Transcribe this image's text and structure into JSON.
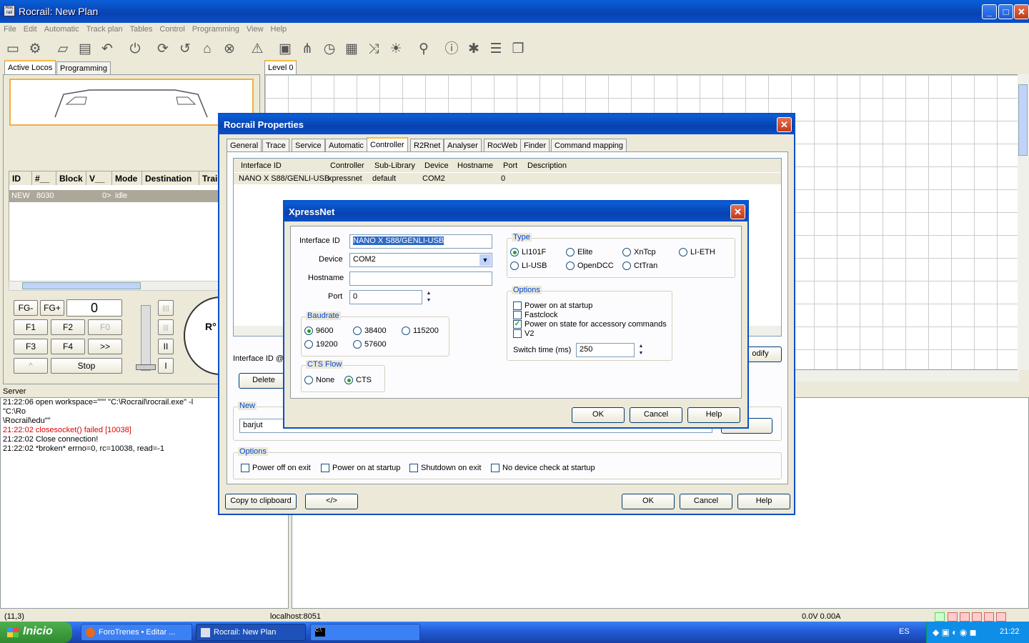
{
  "window": {
    "title": "Rocrail: New Plan",
    "icon": "app-icon",
    "minimize": "_",
    "maximize": "□",
    "close": "✕"
  },
  "menu": [
    "File",
    "Edit",
    "Automatic",
    "Track plan",
    "Tables",
    "Control",
    "Programming",
    "View",
    "Help"
  ],
  "toolbar_icons": [
    "server-icon",
    "gear-icon",
    "folder-icon",
    "save-icon",
    "undo-icon",
    "power-icon",
    "sync-icon",
    "reload-icon",
    "home-icon",
    "stop-icon",
    "warning-icon",
    "locomotive-icon",
    "switch-icon",
    "clock-icon",
    "block-icon",
    "shuffle-icon",
    "light-icon",
    "zoom-icon",
    "info-icon",
    "bug-icon",
    "list-icon",
    "list2-icon"
  ],
  "left_tabs": [
    "Active Locos",
    "Programming"
  ],
  "loco_table": {
    "headers": [
      "ID",
      "#__",
      "Block",
      "V__",
      "Mode",
      "Destination",
      "Train"
    ],
    "row": [
      "NEW",
      "8030",
      "",
      "0>",
      "idle",
      "",
      ""
    ]
  },
  "fkeys": {
    "fgminus": "FG-",
    "fgplus": "FG+",
    "speed": "0",
    "f1": "F1",
    "f2": "F2",
    "f0": "F0",
    "f3": "F3",
    "f4": "F4",
    "more": ">>",
    "up": "^",
    "stop": "Stop",
    "pause": "II",
    "bar": "I",
    "dash": "||||",
    "dash2": "|||"
  },
  "plan_tab": "Level 0",
  "server_label": "Server",
  "log": [
    {
      "text": "21:22:06 open workspace=\"\"\" \"C:\\Rocrail\\rocrail.exe\" -l \"C:\\Ro",
      "color": "#000"
    },
    {
      "text": "\\Rocrail\\edu\"\"",
      "color": "#000"
    },
    {
      "text": "21:22:02 closesocket() failed [10038]",
      "color": "#e00000"
    },
    {
      "text": "21:22:02 Close connection!",
      "color": "#000"
    },
    {
      "text": "21:22:02 *broken* errno=0, rc=10038, read=-1",
      "color": "#000"
    }
  ],
  "props": {
    "title": "Rocrail Properties",
    "tabs": [
      "General",
      "Trace",
      "Service",
      "Automatic",
      "Controller",
      "R2Rnet",
      "Analyser",
      "RocWeb",
      "Finder",
      "Command mapping"
    ],
    "table_headers": [
      "Interface ID",
      "Controller",
      "Sub-Library",
      "Device",
      "Hostname",
      "Port",
      "Description"
    ],
    "row": [
      "NANO X S88/GENLI-USB",
      "xpressnet",
      "default",
      "COM2",
      "",
      "0",
      ""
    ],
    "interface_label": "Interface ID @",
    "delete": "Delete",
    "modify": "odify",
    "new_label": "New",
    "new_value": "barjut",
    "add": "d",
    "options_label": "Options",
    "options": [
      "Power off on exit",
      "Power on at startup",
      "Shutdown on exit",
      "No device check at startup"
    ],
    "copy": "Copy to clipboard",
    "code": "</>",
    "ok": "OK",
    "cancel": "Cancel",
    "help": "Help"
  },
  "xnet": {
    "title": "XpressNet",
    "interface_label": "Interface ID",
    "interface_value": "NANO X S88/GENLI-USB",
    "device_label": "Device",
    "device_value": "COM2",
    "hostname_label": "Hostname",
    "hostname_value": "",
    "port_label": "Port",
    "port_value": "0",
    "baud_label": "Baudrate",
    "bauds": [
      "9600",
      "38400",
      "115200",
      "19200",
      "57600"
    ],
    "cts_label": "CTS Flow",
    "cts": [
      "None",
      "CTS"
    ],
    "type_label": "Type",
    "types": [
      "LI101F",
      "Elite",
      "XnTcp",
      "LI-ETH",
      "LI-USB",
      "OpenDCC",
      "CtTran"
    ],
    "options_label": "Options",
    "options": [
      "Power on at startup",
      "Fastclock",
      "Power on state for accessory commands",
      "V2"
    ],
    "switch_label": "Switch time (ms)",
    "switch_value": "250",
    "ok": "OK",
    "cancel": "Cancel",
    "help": "Help"
  },
  "status": {
    "pos": "(11,3)",
    "host": "localhost:8051",
    "power": "0.0V 0.00A"
  },
  "taskbar": {
    "start": "Inicio",
    "tasks": [
      "ForoTrenes • Editar ...",
      "Rocrail: New Plan",
      ""
    ],
    "lang": "ES",
    "time": "21:22"
  }
}
